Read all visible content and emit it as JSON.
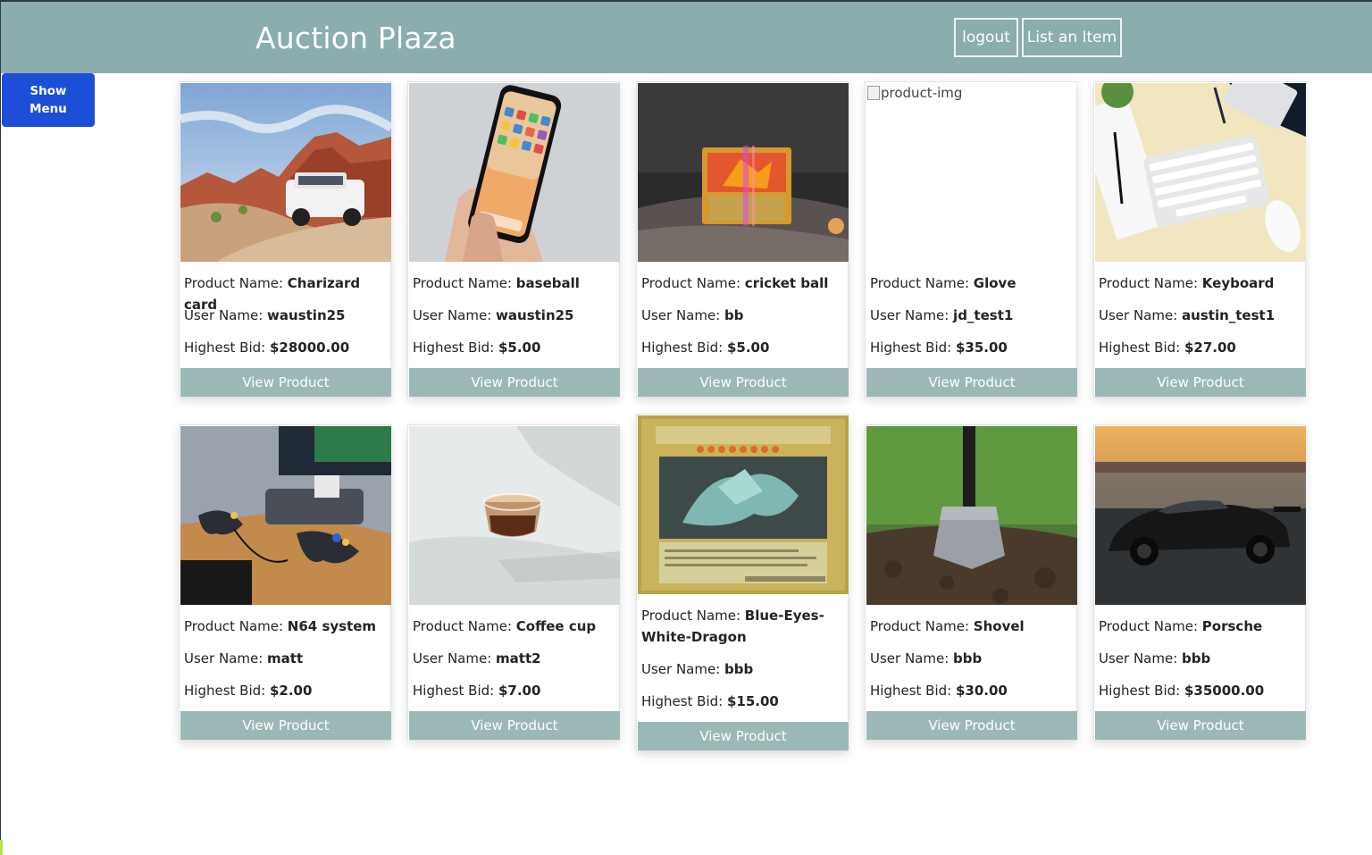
{
  "header": {
    "title": "Auction Plaza",
    "logout_label": "logout",
    "list_item_label": "List an Item"
  },
  "sidebar_toggle": {
    "line1": "Show",
    "line2": "Menu"
  },
  "labels": {
    "product_name": "Product Name: ",
    "user_name": "User Name: ",
    "highest_bid": "Highest Bid: ",
    "view_product": "View Product",
    "broken_image_alt": "product-img"
  },
  "products": [
    {
      "name": "Charizard card",
      "user": "waustin25",
      "bid": "$28000.00",
      "image": "white SUV in red rock desert"
    },
    {
      "name": "baseball",
      "user": "waustin25",
      "bid": "$5.00",
      "image": "hand holding smartphone"
    },
    {
      "name": "cricket ball",
      "user": "bb",
      "bid": "$5.00",
      "image": "holographic trading card"
    },
    {
      "name": "Glove",
      "user": "jd_test1",
      "bid": "$35.00",
      "image": "broken"
    },
    {
      "name": "Keyboard",
      "user": "austin_test1",
      "bid": "$27.00",
      "image": "keyboard and mouse on desk"
    },
    {
      "name": "N64 system",
      "user": "matt",
      "bid": "$2.00",
      "image": "game console with controllers"
    },
    {
      "name": "Coffee cup",
      "user": "matt2",
      "bid": "$7.00",
      "image": "glass coffee cup in shadows"
    },
    {
      "name": "Blue-Eyes-White-Dragon",
      "name_line1": "Blue-Eyes-",
      "name_line2": "White-Dragon",
      "user": "bbb",
      "bid": "$15.00",
      "image": "dragon trading card"
    },
    {
      "name": "Shovel",
      "user": "bbb",
      "bid": "$30.00",
      "image": "shovel in dirt"
    },
    {
      "name": "Porsche",
      "user": "bbb",
      "bid": "$35000.00",
      "image": "black sports car at sunset"
    }
  ],
  "colors": {
    "header_bg": "#8badad",
    "button_bg": "#9bb8b7",
    "show_menu_bg": "#1d4ed8"
  }
}
